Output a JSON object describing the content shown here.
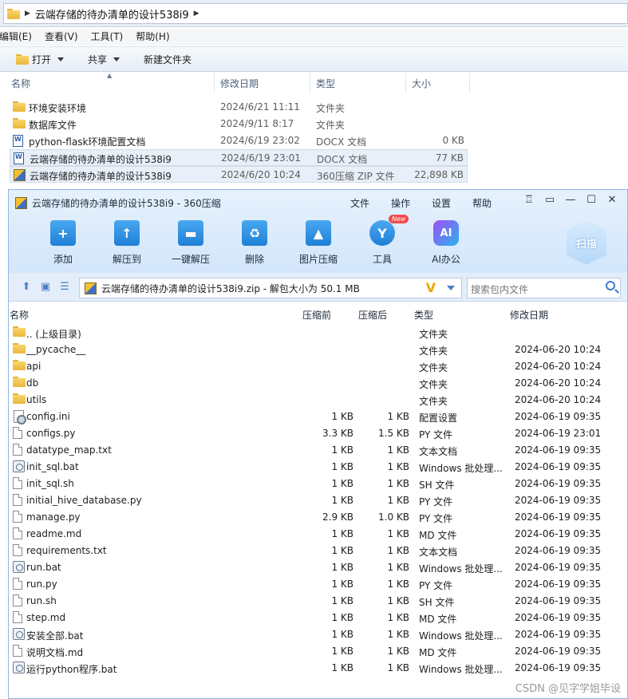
{
  "explorer": {
    "path": "云端存储的待办清单的设计538i9",
    "menu": [
      "编辑(E)",
      "查看(V)",
      "工具(T)",
      "帮助(H)"
    ],
    "toolbar": {
      "open": "打开",
      "share": "共享",
      "new_folder": "新建文件夹"
    },
    "columns": {
      "name": "名称",
      "modified": "修改日期",
      "type": "类型",
      "size": "大小"
    },
    "files": [
      {
        "icon": "folder-icon",
        "name": "环境安装环境",
        "modified": "2024/6/21 11:11",
        "type": "文件夹",
        "size": ""
      },
      {
        "icon": "folder-icon",
        "name": "数据库文件",
        "modified": "2024/9/11 8:17",
        "type": "文件夹",
        "size": ""
      },
      {
        "icon": "word-doc-icon",
        "name": "python-flask环境配置文档",
        "modified": "2024/6/19 23:02",
        "type": "DOCX 文档",
        "size": "0 KB"
      },
      {
        "icon": "word-doc-icon",
        "name": "云端存储的待办清单的设计538i9",
        "modified": "2024/6/19 23:01",
        "type": "DOCX 文档",
        "size": "77 KB"
      },
      {
        "icon": "zip-archive-icon",
        "name": "云端存储的待办清单的设计538i9",
        "modified": "2024/6/20 10:24",
        "type": "360压缩 ZIP 文件",
        "size": "22,898 KB"
      }
    ]
  },
  "zip_window": {
    "title": "云端存储的待办清单的设计538i9 - 360压缩",
    "menu": [
      "文件",
      "操作",
      "设置",
      "帮助"
    ],
    "tools": [
      {
        "label": "添加",
        "icon": "add-icon",
        "glyph": "+"
      },
      {
        "label": "解压到",
        "icon": "extract-to-icon",
        "glyph": "↑"
      },
      {
        "label": "一键解压",
        "icon": "one-click-extract-icon",
        "glyph": "▬"
      },
      {
        "label": "删除",
        "icon": "recycle-icon",
        "glyph": "♻"
      },
      {
        "label": "图片压缩",
        "icon": "image-compress-icon",
        "glyph": "▲"
      },
      {
        "label": "工具",
        "icon": "tools-icon",
        "glyph": "Y",
        "badge": "New"
      },
      {
        "label": "AI办公",
        "icon": "ai-office-icon",
        "glyph": "AI"
      }
    ],
    "scan_label": "扫描",
    "path_text": "云端存储的待办清单的设计538i9.zip - 解包大小为 50.1 MB",
    "search_placeholder": "搜索包内文件",
    "columns": {
      "name": "名称",
      "compressed_before": "压缩前",
      "compressed_after": "压缩后",
      "type": "类型",
      "modified": "修改日期"
    },
    "entries": [
      {
        "icon": "folder-icon",
        "name": ".. (上级目录)",
        "before": "",
        "after": "",
        "type": "文件夹",
        "modified": ""
      },
      {
        "icon": "folder-icon",
        "name": "__pycache__",
        "before": "",
        "after": "",
        "type": "文件夹",
        "modified": "2024-06-20 10:24"
      },
      {
        "icon": "folder-icon",
        "name": "api",
        "before": "",
        "after": "",
        "type": "文件夹",
        "modified": "2024-06-20 10:24"
      },
      {
        "icon": "folder-icon",
        "name": "db",
        "before": "",
        "after": "",
        "type": "文件夹",
        "modified": "2024-06-20 10:24"
      },
      {
        "icon": "folder-icon",
        "name": "utils",
        "before": "",
        "after": "",
        "type": "文件夹",
        "modified": "2024-06-20 10:24"
      },
      {
        "icon": "config-file-icon",
        "name": "config.ini",
        "before": "1 KB",
        "after": "1 KB",
        "type": "配置设置",
        "modified": "2024-06-19 09:35"
      },
      {
        "icon": "file-icon",
        "name": "configs.py",
        "before": "3.3 KB",
        "after": "1.5 KB",
        "type": "PY 文件",
        "modified": "2024-06-19 23:01"
      },
      {
        "icon": "file-icon",
        "name": "datatype_map.txt",
        "before": "1 KB",
        "after": "1 KB",
        "type": "文本文档",
        "modified": "2024-06-19 09:35"
      },
      {
        "icon": "batch-file-icon",
        "name": "init_sql.bat",
        "before": "1 KB",
        "after": "1 KB",
        "type": "Windows 批处理...",
        "modified": "2024-06-19 09:35"
      },
      {
        "icon": "file-icon",
        "name": "init_sql.sh",
        "before": "1 KB",
        "after": "1 KB",
        "type": "SH 文件",
        "modified": "2024-06-19 09:35"
      },
      {
        "icon": "file-icon",
        "name": "initial_hive_database.py",
        "before": "1 KB",
        "after": "1 KB",
        "type": "PY 文件",
        "modified": "2024-06-19 09:35"
      },
      {
        "icon": "file-icon",
        "name": "manage.py",
        "before": "2.9 KB",
        "after": "1.0 KB",
        "type": "PY 文件",
        "modified": "2024-06-19 09:35"
      },
      {
        "icon": "file-icon",
        "name": "readme.md",
        "before": "1 KB",
        "after": "1 KB",
        "type": "MD 文件",
        "modified": "2024-06-19 09:35"
      },
      {
        "icon": "file-icon",
        "name": "requirements.txt",
        "before": "1 KB",
        "after": "1 KB",
        "type": "文本文档",
        "modified": "2024-06-19 09:35"
      },
      {
        "icon": "batch-file-icon",
        "name": "run.bat",
        "before": "1 KB",
        "after": "1 KB",
        "type": "Windows 批处理...",
        "modified": "2024-06-19 09:35"
      },
      {
        "icon": "file-icon",
        "name": "run.py",
        "before": "1 KB",
        "after": "1 KB",
        "type": "PY 文件",
        "modified": "2024-06-19 09:35"
      },
      {
        "icon": "file-icon",
        "name": "run.sh",
        "before": "1 KB",
        "after": "1 KB",
        "type": "SH 文件",
        "modified": "2024-06-19 09:35"
      },
      {
        "icon": "file-icon",
        "name": "step.md",
        "before": "1 KB",
        "after": "1 KB",
        "type": "MD 文件",
        "modified": "2024-06-19 09:35"
      },
      {
        "icon": "batch-file-icon",
        "name": "安装全部.bat",
        "before": "1 KB",
        "after": "1 KB",
        "type": "Windows 批处理...",
        "modified": "2024-06-19 09:35"
      },
      {
        "icon": "file-icon",
        "name": "说明文档.md",
        "before": "1 KB",
        "after": "1 KB",
        "type": "MD 文件",
        "modified": "2024-06-19 09:35"
      },
      {
        "icon": "batch-file-icon",
        "name": "运行python程序.bat",
        "before": "1 KB",
        "after": "1 KB",
        "type": "Windows 批处理...",
        "modified": "2024-06-19 09:35"
      }
    ]
  },
  "watermark": "CSDN @见字学姐毕设"
}
